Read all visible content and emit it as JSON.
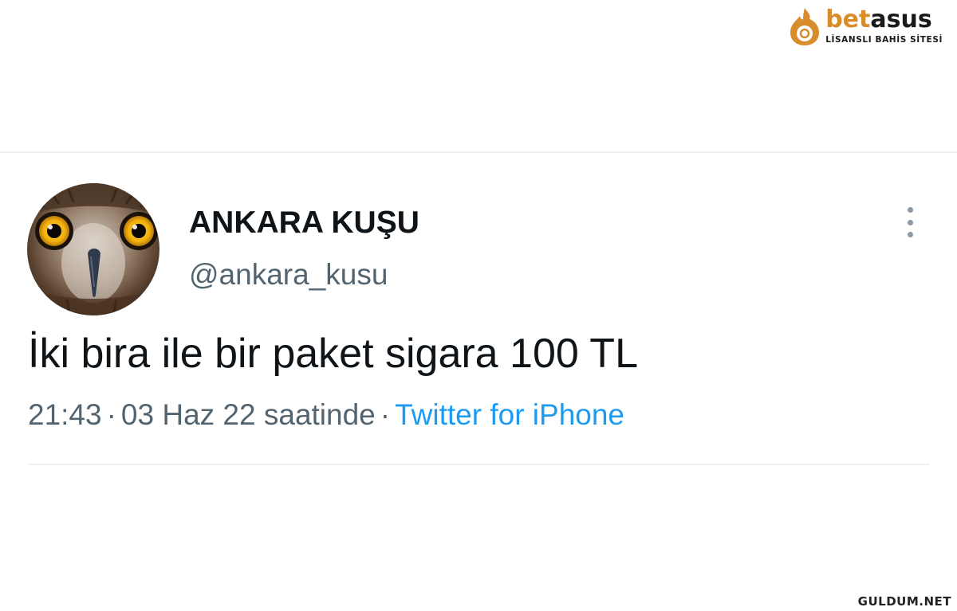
{
  "brand": {
    "name_part1": "bet",
    "name_part2": "asus",
    "tagline": "LİSANSLI BAHİS SİTESİ",
    "color_primary": "#d98c2c",
    "color_dark": "#1a1a1a"
  },
  "tweet": {
    "avatar_icon": "owl-avatar",
    "display_name": "ANKARA KUŞU",
    "handle": "@ankara_kusu",
    "text": "İki bira ile bir paket sigara 100 TL",
    "time": "21:43",
    "separator": "·",
    "date_text": "03 Haz 22 saatinde",
    "source": "Twitter for iPhone",
    "more_icon": "more-vertical-icon",
    "colors": {
      "text": "#0f1419",
      "secondary": "#536471",
      "link": "#1d9bf0"
    }
  },
  "watermark": {
    "text": "GULDUM.NET"
  }
}
